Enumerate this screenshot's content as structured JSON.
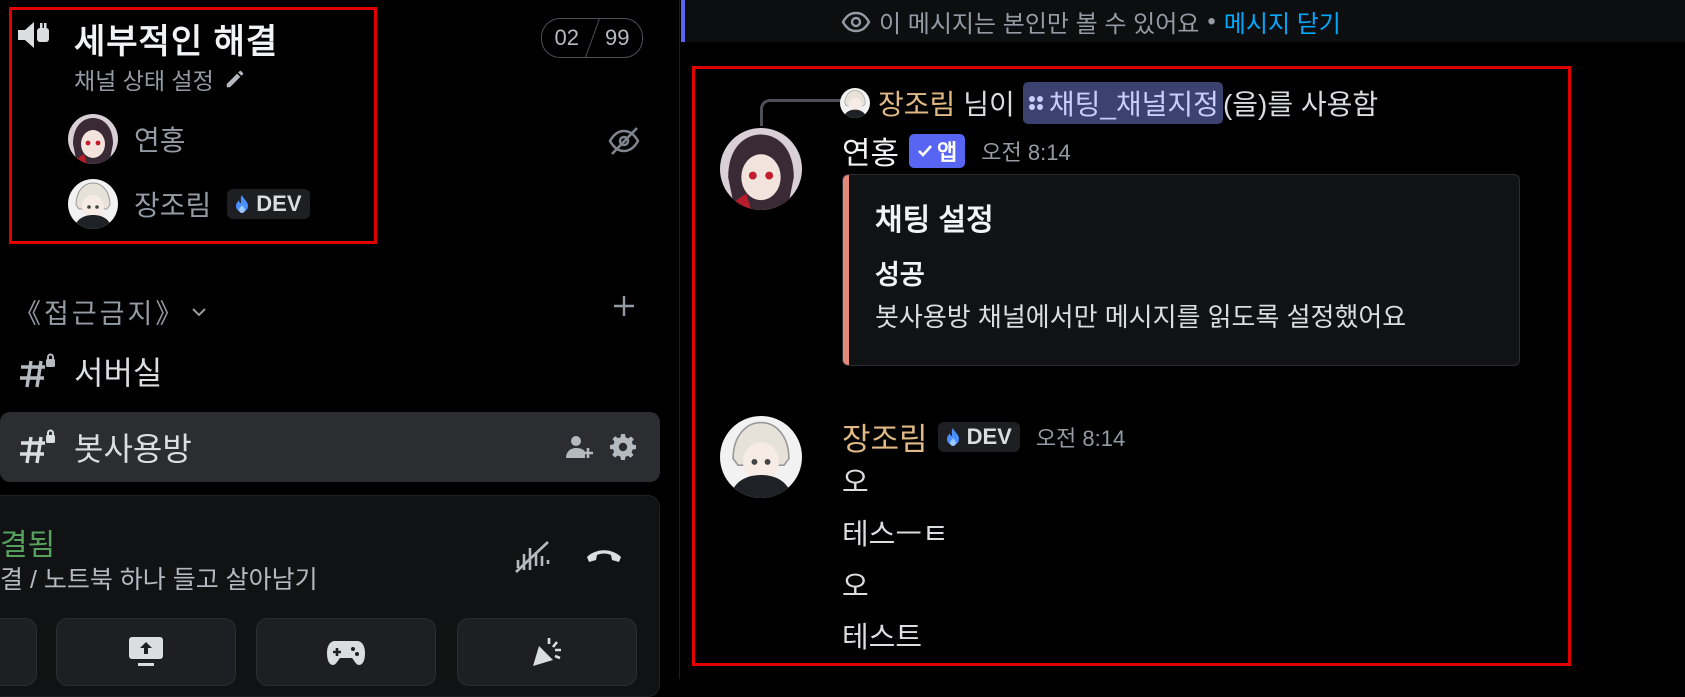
{
  "sidebar": {
    "voice_channel": {
      "title": "세부적인 해결",
      "status": "채널 상태 설정",
      "counter_current": "02",
      "counter_limit": "99",
      "users": [
        {
          "name": "연홍"
        },
        {
          "name": "장조림",
          "badge": "DEV"
        }
      ]
    },
    "category": {
      "name": "《접근금지》"
    },
    "channels": [
      {
        "name": "서버실"
      },
      {
        "name": "봇사용방"
      }
    ],
    "voice_panel": {
      "status": "결됨",
      "subtitle": "결 / 노트북 하나 들고 살아남기"
    }
  },
  "chat": {
    "ephemeral": {
      "text": "이 메시지는 본인만 볼 수 있어요",
      "separator": "•",
      "dismiss": "메시지 닫기"
    },
    "reply": {
      "user": "장조림",
      "mid": "님이",
      "command": "채팅_채널지정",
      "suffix": "(을)를 사용함"
    },
    "messages": [
      {
        "author": "연홍",
        "tag": "앱",
        "time": "오전 8:14",
        "embed": {
          "title": "채팅 설정",
          "field_name": "성공",
          "field_value": "봇사용방 채널에서만 메시지를 읽도록 설정했어요"
        }
      },
      {
        "author": "장조림",
        "tag": "DEV",
        "time": "오전 8:14",
        "lines": [
          "오",
          "테스ㅡㅌ",
          "오",
          "테스트"
        ]
      }
    ]
  },
  "colors": {
    "accent": "#5865f2",
    "link": "#00a8fc",
    "embed_bar": "#e3897a",
    "connected_green": "#57a05d",
    "highlight_box": "#e00000",
    "author_tan": "#e0b985"
  }
}
